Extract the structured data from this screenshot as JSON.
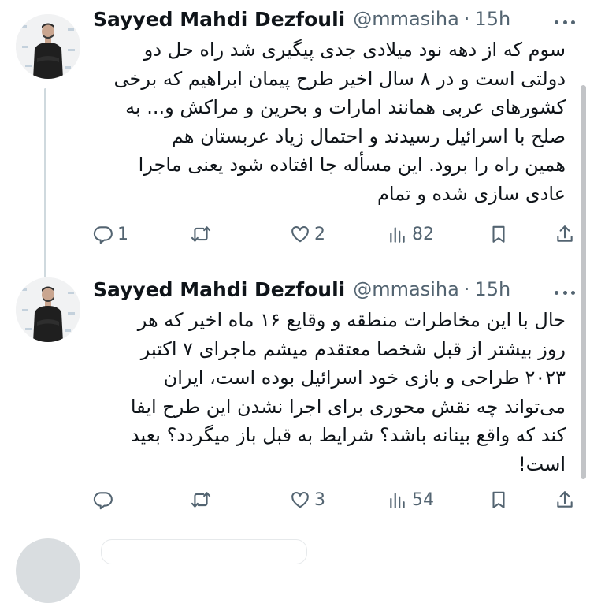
{
  "tweets": [
    {
      "author": "Sayyed Mahdi Dezfouli",
      "handle": "@mmasiha",
      "separator": "·",
      "time": "15h",
      "text": "سوم که از دهه نود میلادی جدی پیگیری شد راه حل دو\nدولتی است و در ۸ سال اخیر طرح پیمان ابراهیم که برخی\nکشورهای عربی همانند امارات و بحرین و مراکش و... به\nصلح با اسرائیل رسیدند و احتمال زیاد عربستان هم\nهمین راه را برود. این مسأله جا افتاده شود یعنی ماجرا\nعادی سازی شده و تمام",
      "replies": "1",
      "retweets": "",
      "likes": "2",
      "views": "82"
    },
    {
      "author": "Sayyed Mahdi Dezfouli",
      "handle": "@mmasiha",
      "separator": "·",
      "time": "15h",
      "text": "حال با این مخاطرات منطقه و وقایع ۱۶ ماه اخیر که هر\nروز بیشتر از قبل شخصا معتقدم میشم ماجرای ۷ اکتبر\n۲۰۲۳ طراحی و بازی خود اسرائیل بوده است، ایران\nمی‌تواند چه نقش محوری برای اجرا نشدن این طرح ایفا\nکند که واقع بینانه باشد؟ شرایط به قبل باز میگردد؟ بعید\nاست!",
      "replies": "",
      "retweets": "",
      "likes": "3",
      "views": "54"
    }
  ],
  "icons": {
    "reply": "reply-icon",
    "retweet": "retweet-icon",
    "like": "heart-icon",
    "views": "views-icon",
    "bookmark": "bookmark-icon",
    "share": "share-icon",
    "more": "more-icon"
  },
  "colors": {
    "text": "#0f1419",
    "secondary": "#536471",
    "thread_line": "#cfd9de"
  }
}
